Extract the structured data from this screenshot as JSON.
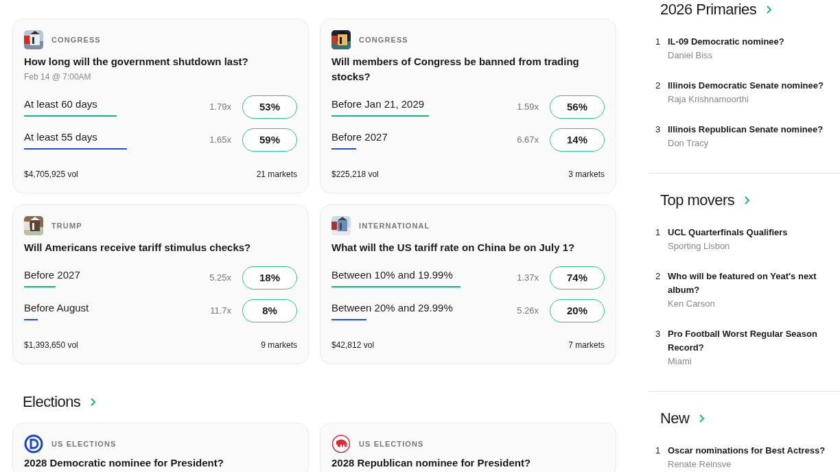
{
  "cards": [
    {
      "thumb": {
        "kind": "picture"
      },
      "category": "CONGRESS",
      "title": "How long will the government shutdown last?",
      "date": "Feb 14 @ 7:00AM",
      "outcomes": [
        {
          "label": "At least 60 days",
          "multiplier": "1.79x",
          "chance": "53%",
          "color": "#10b981"
        },
        {
          "label": "At least 55 days",
          "multiplier": "1.65x",
          "chance": "59%",
          "color": "#1d4ed8"
        }
      ],
      "volume": "$4,705,925 vol",
      "markets": "21 markets"
    },
    {
      "thumb": {
        "kind": "picture"
      },
      "category": "CONGRESS",
      "title": "Will members of Congress be banned from trading stocks?",
      "outcomes": [
        {
          "label": "Before Jan 21, 2029",
          "multiplier": "1.59x",
          "chance": "56%",
          "color": "#10b981"
        },
        {
          "label": "Before 2027",
          "multiplier": "6.67x",
          "chance": "14%",
          "color": "#1d4ed8"
        }
      ],
      "volume": "$225,218 vol",
      "markets": "3 markets"
    },
    {
      "thumb": {
        "kind": "picture"
      },
      "category": "TRUMP",
      "title": "Will Americans receive tariff stimulus checks?",
      "outcomes": [
        {
          "label": "Before 2027",
          "multiplier": "5.25x",
          "chance": "18%",
          "color": "#10b981"
        },
        {
          "label": "Before August",
          "multiplier": "11.7x",
          "chance": "8%",
          "color": "#1d4ed8"
        }
      ],
      "volume": "$1,393,650 vol",
      "markets": "9 markets"
    },
    {
      "thumb": {
        "kind": "picture"
      },
      "category": "INTERNATIONAL",
      "title": "What will the US tariff rate on China be on July 1?",
      "outcomes": [
        {
          "label": "Between 10% and 19.99%",
          "multiplier": "1.37x",
          "chance": "74%",
          "color": "#10b981"
        },
        {
          "label": "Between 20% and 29.99%",
          "multiplier": "5.26x",
          "chance": "20%",
          "color": "#1d4ed8"
        }
      ],
      "volume": "$42,812 vol",
      "markets": "7 markets"
    }
  ],
  "elections": {
    "heading": "Elections",
    "cards": [
      {
        "thumb": {
          "kind": "ring-logo"
        },
        "category": "US ELECTIONS",
        "title": "2028 Democratic nominee for President?"
      },
      {
        "thumb": {
          "kind": "elephant-logo"
        },
        "category": "US ELECTIONS",
        "title": "2028 Republican nominee for President?"
      }
    ]
  },
  "sidebar": [
    {
      "heading": "2026 Primaries",
      "items": [
        {
          "rank": "1",
          "title": "IL-09 Democratic nominee?",
          "leader": "Daniel Biss"
        },
        {
          "rank": "2",
          "title": "Illinois Democratic Senate nominee?",
          "leader": "Raja Krishnamoorthi"
        },
        {
          "rank": "3",
          "title": "Illinois Republican Senate nominee?",
          "leader": "Don Tracy"
        }
      ]
    },
    {
      "heading": "Top movers",
      "items": [
        {
          "rank": "1",
          "title": "UCL Quarterfinals Qualifiers",
          "leader": "Sporting Lisbon"
        },
        {
          "rank": "2",
          "title": "Who will be featured on Yeat's next album?",
          "leader": "Ken Carson"
        },
        {
          "rank": "3",
          "title": "Pro Football Worst Regular Season Record?",
          "leader": "Miami"
        }
      ]
    },
    {
      "heading": "New",
      "items": [
        {
          "rank": "1",
          "title": "Oscar nominations for Best Actress?",
          "leader": "Renate Reinsve"
        }
      ]
    }
  ]
}
